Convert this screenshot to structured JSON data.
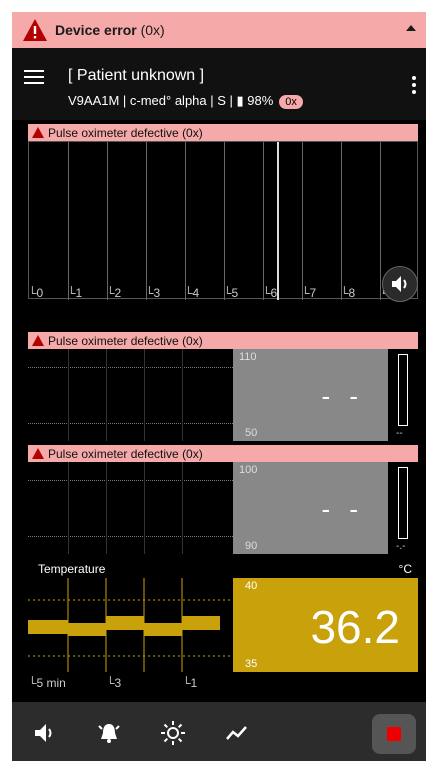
{
  "error_bar": {
    "title": "Device error",
    "count": "(0x)"
  },
  "header": {
    "patient": "[ Patient unknown ]",
    "device_info": "V9AA1M | c-med° alpha | S | ▮ 98%",
    "badge": "0x"
  },
  "pleth": {
    "alert": "Pulse oximeter defective (0x)",
    "ticks": [
      "0",
      "1",
      "2",
      "3",
      "4",
      "5",
      "6",
      "7",
      "8",
      "9"
    ]
  },
  "vital1": {
    "alert": "Pulse oximeter defective (0x)",
    "high": "110",
    "low": "50",
    "value": "- -",
    "unit": "--"
  },
  "vital2": {
    "alert": "Pulse oximeter defective (0x)",
    "high": "100",
    "low": "90",
    "value": "- -",
    "unit": "-.-"
  },
  "temperature": {
    "label": "Temperature",
    "unit": "°C",
    "high": "40",
    "low": "35",
    "value": "36.2",
    "ticks": [
      "5 min",
      "3",
      "1"
    ]
  },
  "colors": {
    "alert": "#f5a9a9",
    "temp_box": "#c9a10b",
    "stop": "#e00000"
  },
  "icons": [
    "volume-icon",
    "alarm-bell-icon",
    "brightness-icon",
    "trend-icon",
    "stop-icon"
  ]
}
